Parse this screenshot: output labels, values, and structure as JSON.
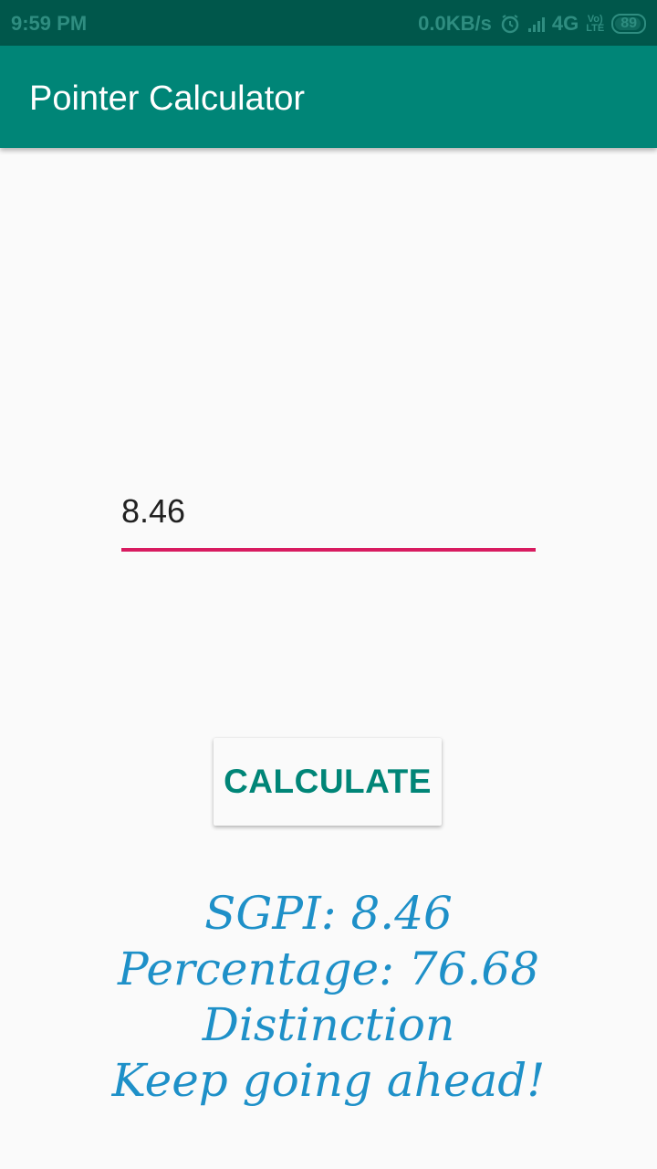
{
  "status_bar": {
    "time": "9:59 PM",
    "net_speed": "0.0KB/s",
    "network_type": "4G",
    "volte_top": "Vo)",
    "volte_bottom": "LTE",
    "battery": "89",
    "icons": [
      "alarm-icon",
      "signal-icon",
      "battery-icon"
    ]
  },
  "app_bar": {
    "title": "Pointer Calculator"
  },
  "input": {
    "value": "8.46"
  },
  "button": {
    "label": "CALCULATE"
  },
  "results": {
    "sgpi": "SGPI: 8.46",
    "percentage": "Percentage: 76.68",
    "grade": "Distinction",
    "message": "Keep going ahead!"
  },
  "colors": {
    "status_bar": "#00574b",
    "app_bar": "#008577",
    "accent": "#d81b60",
    "result_text": "#1e90c8",
    "background": "#fafafa"
  }
}
